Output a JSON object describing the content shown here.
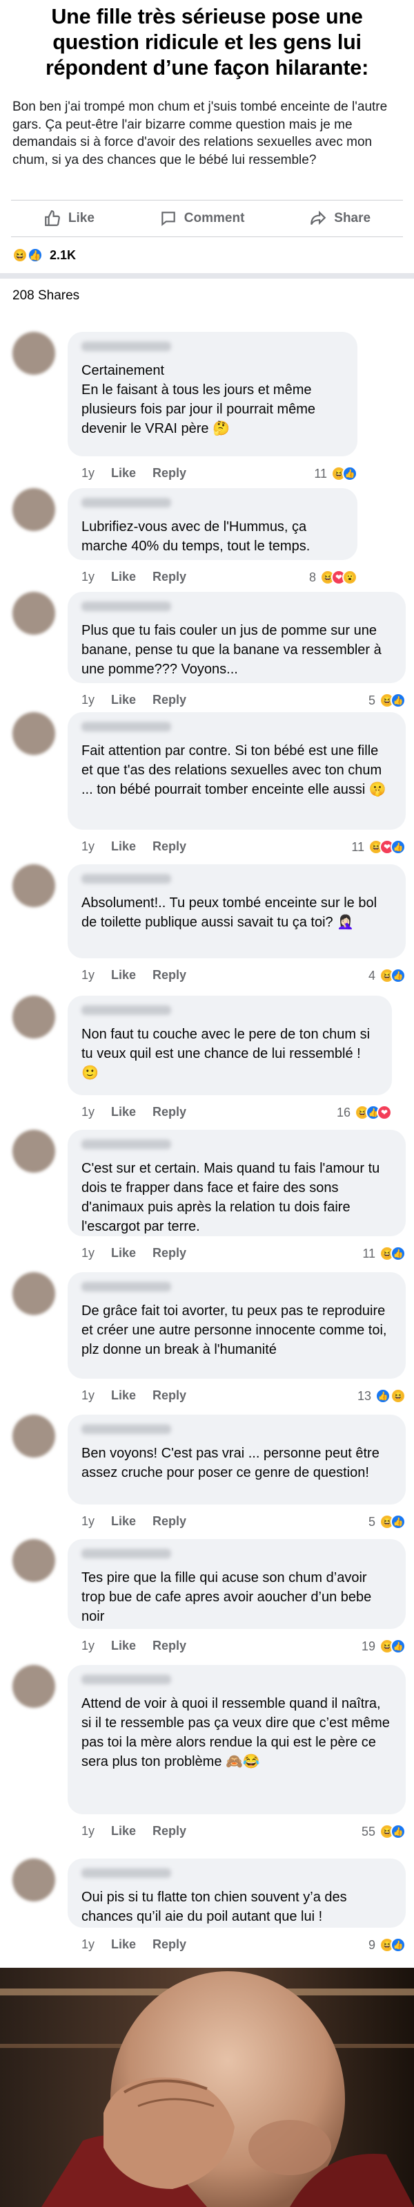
{
  "headline": "Une fille très sérieuse pose une question ridicule et les gens lui répondent d’une façon hilarante:",
  "post": {
    "text": "Bon ben j'ai trompé mon chum et j'suis tombé enceinte de l'autre gars. Ça peut-être l'air bizarre comme question mais je me demandais si à force d'avoir des relations sexuelles avec mon chum, si ya des chances que le bébé lui ressemble?"
  },
  "actions": {
    "like": "Like",
    "comment": "Comment",
    "share": "Share"
  },
  "reactions": {
    "count": "2.1K"
  },
  "shares": "208 Shares",
  "comment_labels": {
    "like": "Like",
    "reply": "Reply"
  },
  "comments": [
    {
      "text": "Certainement\nEn le faisant à tous les jours et même plusieurs fois par jour il pourrait même devenir le VRAI père 🤔",
      "time": "1y",
      "count": "11",
      "reactions": [
        "haha",
        "like"
      ]
    },
    {
      "text": "Lubrifiez-vous avec de l'Hummus, ça marche 40% du temps, tout le temps.",
      "time": "1y",
      "count": "8",
      "reactions": [
        "haha",
        "love",
        "wow"
      ]
    },
    {
      "text": "Plus que tu fais couler un jus de pomme sur une banane, pense tu que la banane va ressembler à une pomme??? Voyons...",
      "time": "1y",
      "count": "5",
      "reactions": [
        "haha",
        "like"
      ]
    },
    {
      "text": "Fait attention par contre. Si ton bébé est une fille et que t'as des relations sexuelles avec ton chum ... ton bébé pourrait tomber enceinte elle aussi 🤫",
      "time": "1y",
      "count": "11",
      "reactions": [
        "haha",
        "love",
        "like"
      ]
    },
    {
      "text": "Absolument!.. Tu peux tombé enceinte sur le bol de toilette publique aussi savait tu ça toi? 🤦🏻‍♀️",
      "time": "1y",
      "count": "4",
      "reactions": [
        "haha",
        "like"
      ]
    },
    {
      "text": "Non faut tu couche avec le pere de ton chum si tu veux quil est une chance de lui ressemblé ! 🙂",
      "time": "1y",
      "count": "16",
      "reactions": [
        "haha",
        "like",
        "love"
      ]
    },
    {
      "text": "C'est sur et certain. Mais quand tu fais l'amour tu dois te frapper dans face et faire des sons d'animaux puis après la relation tu dois faire l'escargot par terre.",
      "time": "1y",
      "count": "11",
      "reactions": [
        "haha",
        "like"
      ]
    },
    {
      "text": "De grâce fait toi avorter, tu peux pas te reproduire et créer une autre personne innocente comme toi, plz donne un break à l'humanité",
      "time": "1y",
      "count": "13",
      "reactions": [
        "like",
        "haha"
      ]
    },
    {
      "text": "Ben voyons! C'est pas vrai ... personne peut être assez cruche pour poser ce genre de question!",
      "time": "1y",
      "count": "5",
      "reactions": [
        "haha",
        "like"
      ]
    },
    {
      "text": "Tes pire que la fille qui acuse son chum d’avoir trop bue de cafe apres avoir aoucher d’un bebe noir",
      "time": "1y",
      "count": "19",
      "reactions": [
        "haha",
        "like"
      ]
    },
    {
      "text": "Attend de voir à quoi il ressemble quand il naîtra, si il te ressemble pas ça veux dire que c’est même pas toi la mère alors rendue la qui est le père ce sera plus ton problème 🙈😂",
      "time": "1y",
      "count": "55",
      "reactions": [
        "haha",
        "like"
      ]
    },
    {
      "text": "Oui pis si tu flatte ton chien souvent y’a des chances qu’il aie du poil autant que lui !",
      "time": "1y",
      "count": "9",
      "reactions": [
        "haha",
        "like"
      ]
    }
  ],
  "reaction_icons": {
    "haha": "😆",
    "like": "👍",
    "love": "❤",
    "wow": "😮"
  }
}
